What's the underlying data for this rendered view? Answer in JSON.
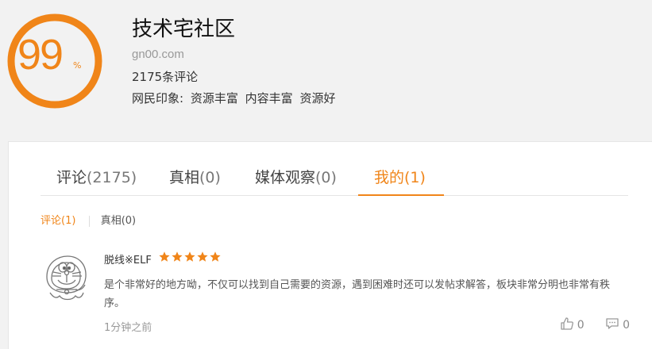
{
  "site": {
    "score": "99",
    "score_unit": "%",
    "score_fraction": 0.99,
    "title": "技术宅社区",
    "domain": "gn00.com",
    "review_count": "2175条评论",
    "impressions_label": "网民印象:",
    "impressions": [
      "资源丰富",
      "内容丰富",
      "资源好"
    ]
  },
  "tabs": [
    {
      "label": "评论",
      "count": "(2175)",
      "active": false
    },
    {
      "label": "真相",
      "count": "(0)",
      "active": false
    },
    {
      "label": "媒体观察",
      "count": "(0)",
      "active": false
    },
    {
      "label": "我的",
      "count": "(1)",
      "active": true
    }
  ],
  "subtabs": [
    {
      "label": "评论(1)",
      "active": true
    },
    {
      "label": "真相(0)",
      "active": false
    }
  ],
  "comment": {
    "user": "脱线※ELF",
    "rating": 5,
    "text": "是个非常好的地方呦，不仅可以找到自己需要的资源，遇到困难时还可以发帖求解答，板块非常分明也非常有秩序。",
    "time": "1分钟之前",
    "likes": "0",
    "replies": "0",
    "avatar_icon": "doraemon-sketch-avatar",
    "like_icon": "thumbs-up-icon",
    "reply_icon": "comment-bubble-icon"
  },
  "colors": {
    "accent": "#f08519",
    "star": "#f08519"
  }
}
